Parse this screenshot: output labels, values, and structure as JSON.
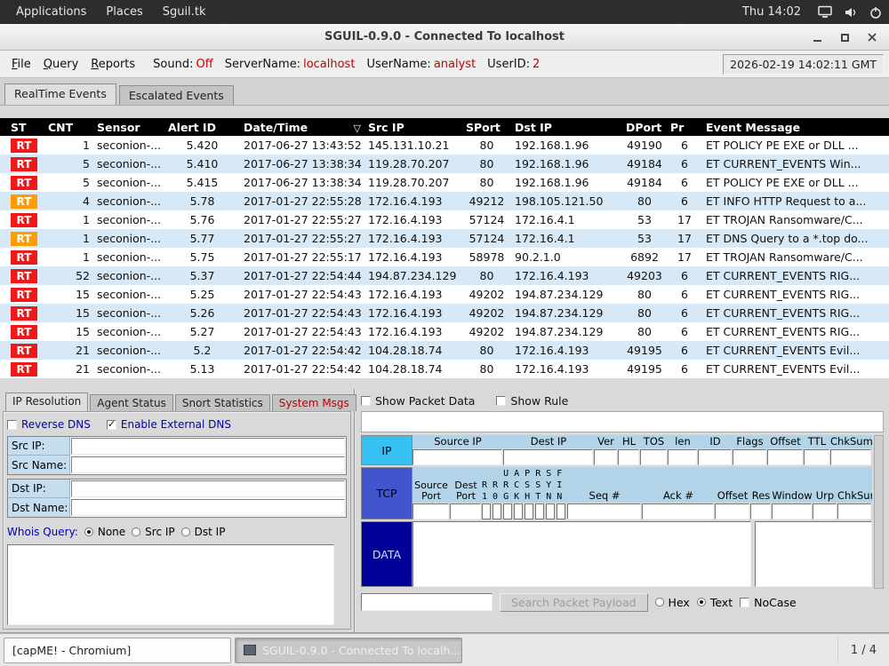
{
  "desktop_bar": {
    "menus": [
      "Applications",
      "Places",
      "Sguil.tk"
    ],
    "clock": "Thu 14:02"
  },
  "window": {
    "title": "SGUIL-0.9.0 - Connected To localhost"
  },
  "menubar": {
    "menus": [
      "File",
      "Query",
      "Reports"
    ],
    "sound_label": "Sound:",
    "sound_value": "Off",
    "servername_label": "ServerName:",
    "servername_value": "localhost",
    "username_label": "UserName:",
    "username_value": "analyst",
    "userid_label": "UserID:",
    "userid_value": "2",
    "timestamp": "2026-02-19 14:02:11 GMT"
  },
  "notebook": {
    "tabs": [
      "RealTime Events",
      "Escalated Events"
    ]
  },
  "events_table": {
    "columns": [
      "ST",
      "CNT",
      "Sensor",
      "Alert ID",
      "Date/Time",
      "Src IP",
      "SPort",
      "Dst IP",
      "DPort",
      "Pr",
      "Event Message"
    ],
    "sort_indicator": "▽",
    "rows": [
      {
        "st": "RT",
        "st_color": "red",
        "cnt": "1",
        "sensor": "seconion-...",
        "alert_id": "5.420",
        "datetime": "2017-06-27 13:43:52",
        "src_ip": "145.131.10.21",
        "sport": "80",
        "dst_ip": "192.168.1.96",
        "dport": "49190",
        "pr": "6",
        "message": "ET POLICY PE EXE or DLL ..."
      },
      {
        "st": "RT",
        "st_color": "red",
        "cnt": "5",
        "sensor": "seconion-...",
        "alert_id": "5.410",
        "datetime": "2017-06-27 13:38:34",
        "src_ip": "119.28.70.207",
        "sport": "80",
        "dst_ip": "192.168.1.96",
        "dport": "49184",
        "pr": "6",
        "message": "ET CURRENT_EVENTS Win..."
      },
      {
        "st": "RT",
        "st_color": "red",
        "cnt": "5",
        "sensor": "seconion-...",
        "alert_id": "5.415",
        "datetime": "2017-06-27 13:38:34",
        "src_ip": "119.28.70.207",
        "sport": "80",
        "dst_ip": "192.168.1.96",
        "dport": "49184",
        "pr": "6",
        "message": "ET POLICY PE EXE or DLL ..."
      },
      {
        "st": "RT",
        "st_color": "orange",
        "cnt": "4",
        "sensor": "seconion-...",
        "alert_id": "5.78",
        "datetime": "2017-01-27 22:55:28",
        "src_ip": "172.16.4.193",
        "sport": "49212",
        "dst_ip": "198.105.121.50",
        "dport": "80",
        "pr": "6",
        "message": "ET INFO HTTP Request to a..."
      },
      {
        "st": "RT",
        "st_color": "red",
        "cnt": "1",
        "sensor": "seconion-...",
        "alert_id": "5.76",
        "datetime": "2017-01-27 22:55:27",
        "src_ip": "172.16.4.193",
        "sport": "57124",
        "dst_ip": "172.16.4.1",
        "dport": "53",
        "pr": "17",
        "message": "ET TROJAN Ransomware/C..."
      },
      {
        "st": "RT",
        "st_color": "orange",
        "cnt": "1",
        "sensor": "seconion-...",
        "alert_id": "5.77",
        "datetime": "2017-01-27 22:55:27",
        "src_ip": "172.16.4.193",
        "sport": "57124",
        "dst_ip": "172.16.4.1",
        "dport": "53",
        "pr": "17",
        "message": "ET DNS Query to a *.top do..."
      },
      {
        "st": "RT",
        "st_color": "red",
        "cnt": "1",
        "sensor": "seconion-...",
        "alert_id": "5.75",
        "datetime": "2017-01-27 22:55:17",
        "src_ip": "172.16.4.193",
        "sport": "58978",
        "dst_ip": "90.2.1.0",
        "dport": "6892",
        "pr": "17",
        "message": "ET TROJAN Ransomware/C..."
      },
      {
        "st": "RT",
        "st_color": "red",
        "cnt": "52",
        "sensor": "seconion-...",
        "alert_id": "5.37",
        "datetime": "2017-01-27 22:54:44",
        "src_ip": "194.87.234.129",
        "sport": "80",
        "dst_ip": "172.16.4.193",
        "dport": "49203",
        "pr": "6",
        "message": "ET CURRENT_EVENTS RIG..."
      },
      {
        "st": "RT",
        "st_color": "red",
        "cnt": "15",
        "sensor": "seconion-...",
        "alert_id": "5.25",
        "datetime": "2017-01-27 22:54:43",
        "src_ip": "172.16.4.193",
        "sport": "49202",
        "dst_ip": "194.87.234.129",
        "dport": "80",
        "pr": "6",
        "message": "ET CURRENT_EVENTS RIG..."
      },
      {
        "st": "RT",
        "st_color": "red",
        "cnt": "15",
        "sensor": "seconion-...",
        "alert_id": "5.26",
        "datetime": "2017-01-27 22:54:43",
        "src_ip": "172.16.4.193",
        "sport": "49202",
        "dst_ip": "194.87.234.129",
        "dport": "80",
        "pr": "6",
        "message": "ET CURRENT_EVENTS RIG..."
      },
      {
        "st": "RT",
        "st_color": "red",
        "cnt": "15",
        "sensor": "seconion-...",
        "alert_id": "5.27",
        "datetime": "2017-01-27 22:54:43",
        "src_ip": "172.16.4.193",
        "sport": "49202",
        "dst_ip": "194.87.234.129",
        "dport": "80",
        "pr": "6",
        "message": "ET CURRENT_EVENTS RIG..."
      },
      {
        "st": "RT",
        "st_color": "red",
        "cnt": "21",
        "sensor": "seconion-...",
        "alert_id": "5.2",
        "datetime": "2017-01-27 22:54:42",
        "src_ip": "104.28.18.74",
        "sport": "80",
        "dst_ip": "172.16.4.193",
        "dport": "49195",
        "pr": "6",
        "message": "ET CURRENT_EVENTS Evil..."
      },
      {
        "st": "RT",
        "st_color": "red",
        "cnt": "21",
        "sensor": "seconion-...",
        "alert_id": "5.13",
        "datetime": "2017-01-27 22:54:42",
        "src_ip": "104.28.18.74",
        "sport": "80",
        "dst_ip": "172.16.4.193",
        "dport": "49195",
        "pr": "6",
        "message": "ET CURRENT_EVENTS Evil..."
      }
    ]
  },
  "resolution_panel": {
    "tabs": [
      "IP Resolution",
      "Agent Status",
      "Snort Statistics",
      "System Msgs"
    ],
    "reverse_dns_label": "Reverse DNS",
    "external_dns_label": "Enable External DNS",
    "src_ip_label": "Src IP:",
    "src_name_label": "Src Name:",
    "dst_ip_label": "Dst IP:",
    "dst_name_label": "Dst Name:",
    "whois_label": "Whois Query:",
    "whois_options": [
      "None",
      "Src IP",
      "Dst IP"
    ]
  },
  "packet_panel": {
    "show_packet_data_label": "Show Packet Data",
    "show_rule_label": "Show Rule",
    "ip": {
      "label": "IP",
      "headers": [
        "Source IP",
        "Dest IP",
        "Ver",
        "HL",
        "TOS",
        "len",
        "ID",
        "Flags",
        "Offset",
        "TTL",
        "ChkSum"
      ]
    },
    "tcp": {
      "label": "TCP",
      "source_port": "Source Port",
      "dest_port": "Dest Port",
      "flag_line1": "    U A P R S F",
      "flag_line2": "R R R C S S Y I",
      "flag_line3": "1 0 G K H T N N",
      "seq": "Seq #",
      "ack": "Ack #",
      "offset": "Offset",
      "res": "Res",
      "window": "Window",
      "urp": "Urp",
      "chksum": "ChkSum"
    },
    "data_label": "DATA",
    "search": {
      "button": "Search Packet Payload",
      "hex_label": "Hex",
      "text_label": "Text",
      "nocase_label": "NoCase"
    }
  },
  "taskbar": {
    "capme_label": "[capME! - Chromium]",
    "sguil_task_label": "SGUIL-0.9.0 - Connected To localh...",
    "pager": "1 / 4"
  }
}
